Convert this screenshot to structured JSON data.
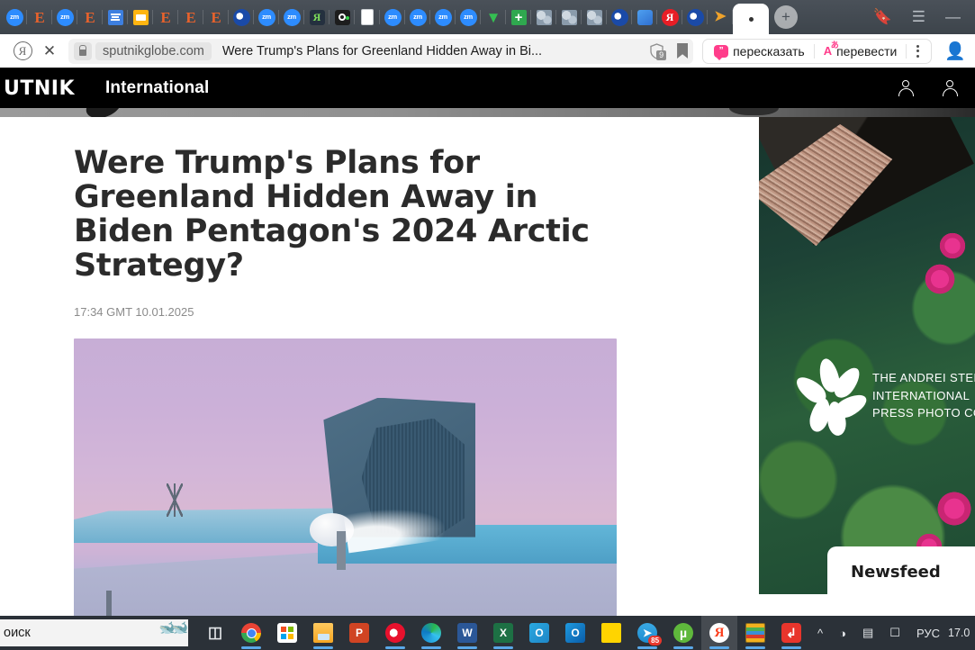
{
  "browser": {
    "tabs": [
      {
        "icon": "zoom-icon",
        "label": "zm"
      },
      {
        "icon": "evernote-icon",
        "label": "E"
      },
      {
        "icon": "zoom-icon",
        "label": "zm"
      },
      {
        "icon": "evernote-icon",
        "label": "E"
      },
      {
        "icon": "document-list-icon",
        "label": ""
      },
      {
        "icon": "yellow-window-icon",
        "label": ""
      },
      {
        "icon": "evernote-icon",
        "label": "E"
      },
      {
        "icon": "evernote-icon",
        "label": "E"
      },
      {
        "icon": "evernote-icon",
        "label": "E"
      },
      {
        "icon": "opera-icon",
        "label": ""
      },
      {
        "icon": "zoom-icon",
        "label": "zm"
      },
      {
        "icon": "zoom-icon",
        "label": "zm"
      },
      {
        "icon": "yandex-dark-icon",
        "label": "Я"
      },
      {
        "icon": "ocam-icon",
        "label": ""
      },
      {
        "icon": "blank-page-icon",
        "label": ""
      },
      {
        "icon": "zoom-icon",
        "label": "zm"
      },
      {
        "icon": "zoom-icon",
        "label": "zm"
      },
      {
        "icon": "zoom-icon",
        "label": "zm"
      },
      {
        "icon": "zoom-icon",
        "label": "zm"
      },
      {
        "icon": "tradingview-icon",
        "label": "V"
      },
      {
        "icon": "green-plus-icon",
        "label": "+"
      },
      {
        "icon": "globe-icon",
        "label": ""
      },
      {
        "icon": "globe-icon",
        "label": ""
      },
      {
        "icon": "globe-icon",
        "label": ""
      },
      {
        "icon": "opera-icon",
        "label": ""
      },
      {
        "icon": "blue-cube-icon",
        "label": ""
      },
      {
        "icon": "yandex-red-icon",
        "label": "Я"
      },
      {
        "icon": "opera-icon",
        "label": ""
      },
      {
        "icon": "orange-arrow-icon",
        "label": ""
      }
    ],
    "active_tab": {
      "icon": "dot-icon",
      "label": ""
    },
    "new_tab_label": "+",
    "window_controls": {
      "bookmarks_icon": "bookmark-manager-icon",
      "menu_icon": "hamburger-menu-icon",
      "minimize_label": "_"
    },
    "toolbar": {
      "yandex_button": "Я",
      "close_label": "✕",
      "security_icon": "lock-icon",
      "domain": "sputnikglobe.com",
      "page_title": "Were Trump's Plans for Greenland Hidden Away in Bi...",
      "shield_badge": "9",
      "bookmark_icon": "bookmark-icon",
      "summarize_label": "пересказать",
      "summarize_icon": "quote-bubble-icon",
      "translate_label": "перевести",
      "translate_icon": "translate-icon",
      "translate_sup": "あ",
      "menu_icon": "kebab-menu-icon",
      "profile_icon": "user-profile-icon"
    }
  },
  "site": {
    "logo_text": "UTNIK",
    "section": "International",
    "account_icon": "account-icon",
    "login_icon": "login-icon"
  },
  "article": {
    "headline": "Were Trump's Plans for Greenland Hidden Away in Biden Pentagon's 2024 Arctic Strategy?",
    "timestamp": "17:34 GMT 10.01.2025",
    "hero_alt": "arctic-radar-station-photo"
  },
  "sidebar": {
    "ad": {
      "line1": "THE ANDREI STENIN",
      "line2": "INTERNATIONAL",
      "line3": "PRESS PHOTO CONT",
      "logo_icon": "stenin-flower-logo"
    },
    "newsfeed_title": "Newsfeed"
  },
  "taskbar": {
    "search_placeholder": "оиск",
    "search_icon": "whale-icons",
    "items": [
      {
        "name": "task-view",
        "icon": "task-view-icon",
        "running": false
      },
      {
        "name": "chrome",
        "icon": "chrome-icon",
        "running": true
      },
      {
        "name": "microsoft-store",
        "icon": "microsoft-store-icon",
        "running": false
      },
      {
        "name": "file-explorer",
        "icon": "file-explorer-icon",
        "running": true
      },
      {
        "name": "powerpoint",
        "icon": "powerpoint-icon",
        "running": false
      },
      {
        "name": "opera",
        "icon": "opera-icon",
        "running": true
      },
      {
        "name": "edge",
        "icon": "edge-icon",
        "running": true
      },
      {
        "name": "word",
        "icon": "word-icon",
        "running": true
      },
      {
        "name": "excel",
        "icon": "excel-icon",
        "running": true
      },
      {
        "name": "outlook-one",
        "icon": "outlook-icon",
        "running": false
      },
      {
        "name": "outlook",
        "icon": "outlook-icon",
        "running": false
      },
      {
        "name": "sticky-notes",
        "icon": "sticky-notes-icon",
        "running": false
      },
      {
        "name": "telegram",
        "icon": "telegram-icon",
        "running": true,
        "badge": "85"
      },
      {
        "name": "utorrent",
        "icon": "utorrent-icon",
        "running": true
      },
      {
        "name": "yandex-browser",
        "icon": "yandex-browser-icon",
        "running": true,
        "active": true
      },
      {
        "name": "winrar",
        "icon": "winrar-icon",
        "running": true
      },
      {
        "name": "acrobat",
        "icon": "acrobat-icon",
        "running": true
      }
    ],
    "tray": {
      "overflow_icon": "chevron-up-icon",
      "network_icon": "wifi-icon",
      "battery_icon": "battery-icon",
      "camera_icon": "camera-icon",
      "language": "РУС",
      "clock": "17.0"
    }
  },
  "colors": {
    "accent_pink": "#ff3d8b",
    "header_black": "#000000",
    "taskbar": "#2b3138",
    "tabstrip": "#3d444b"
  }
}
